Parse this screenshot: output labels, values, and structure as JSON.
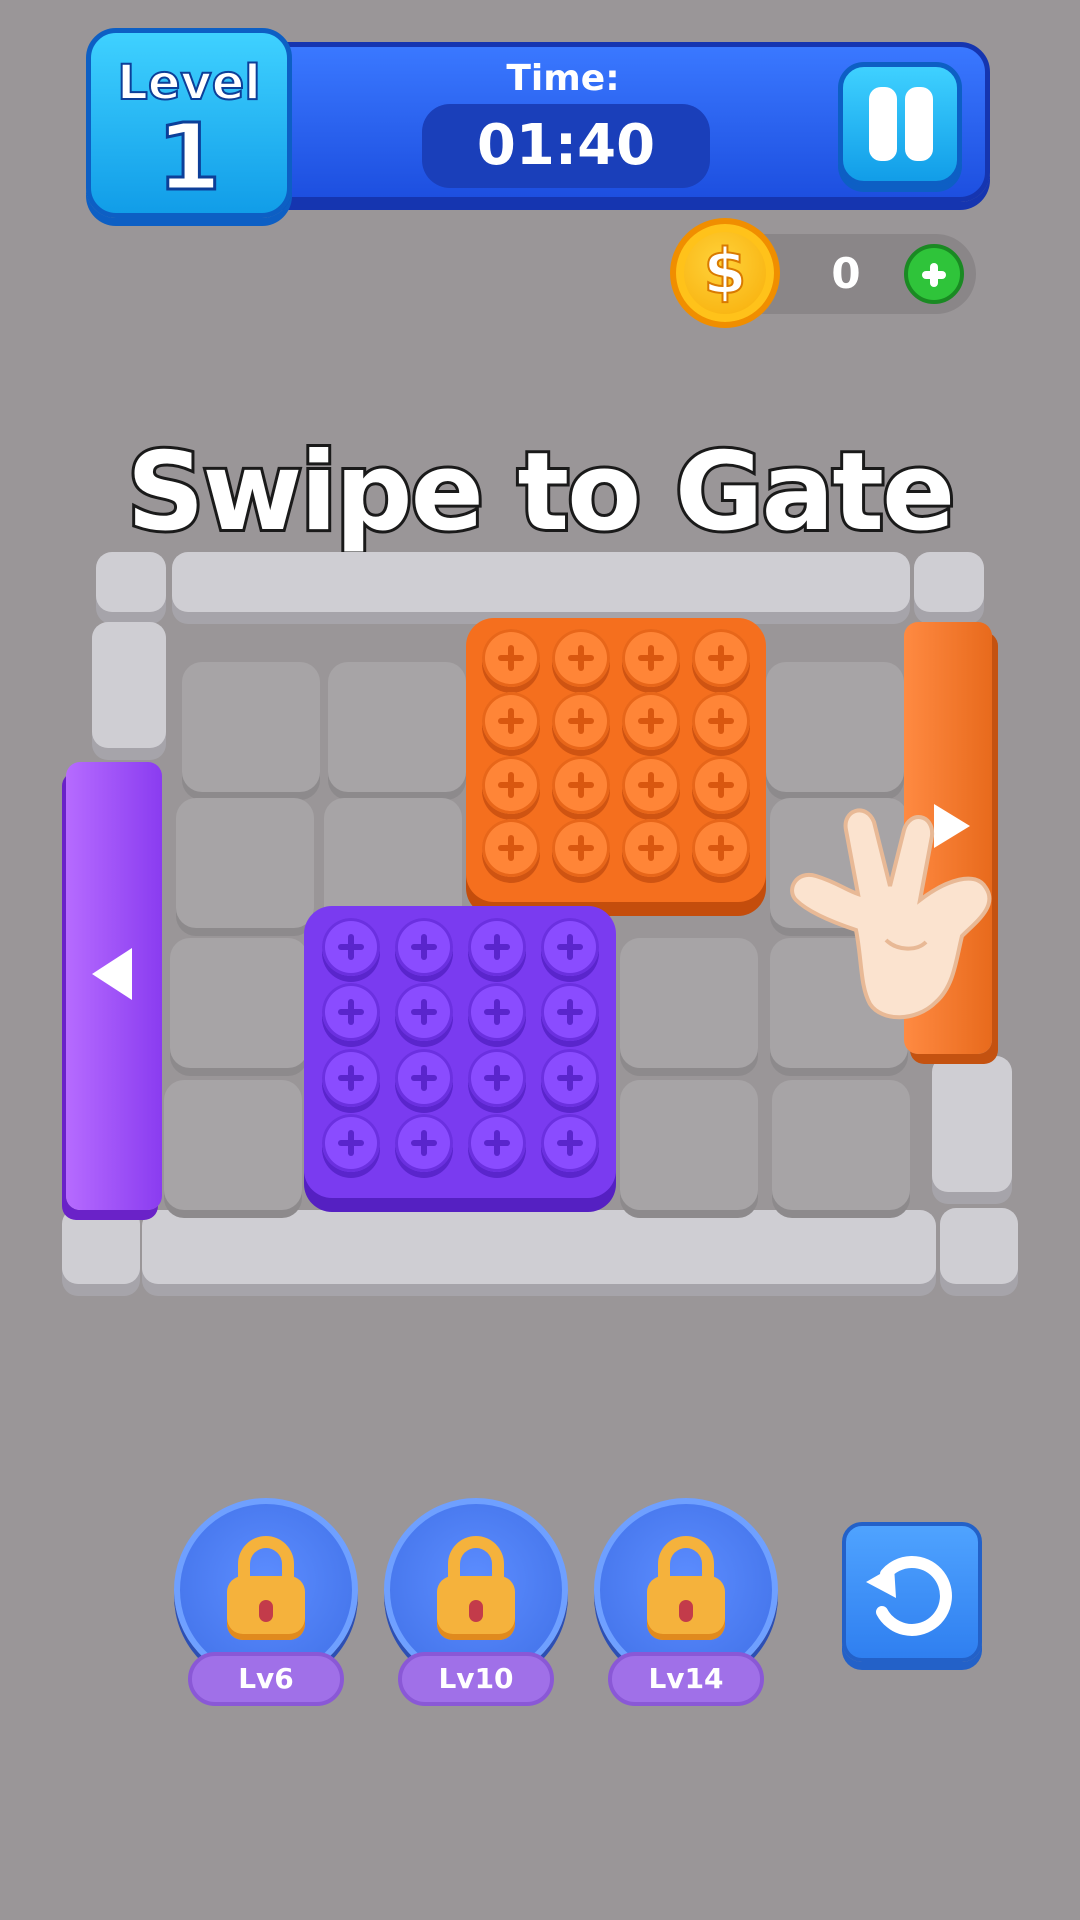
{
  "hud": {
    "level_label": "Level",
    "level_number": "1",
    "time_label": "Time:",
    "time_value": "01:40",
    "coins": "0",
    "icons": [
      "pause-icon",
      "coin-icon",
      "plus-icon"
    ]
  },
  "title": "Swipe to Gate",
  "board": {
    "rows": 4,
    "cols": 5,
    "blocks": [
      {
        "color": "orange",
        "color_hex": "#f56f1e",
        "studs": 16
      },
      {
        "color": "purple",
        "color_hex": "#7a3bf0",
        "studs": 16
      }
    ],
    "gates": [
      {
        "color": "orange",
        "side": "right",
        "arrow": "right"
      },
      {
        "color": "purple",
        "side": "left",
        "arrow": "left"
      }
    ]
  },
  "boosters": [
    {
      "label": "Lv6",
      "locked": true
    },
    {
      "label": "Lv10",
      "locked": true
    },
    {
      "label": "Lv14",
      "locked": true
    }
  ],
  "restart_icon": "restart-icon",
  "colors": {
    "background": "#9a9698",
    "header": "#1d4fe0",
    "accent": "#3fd1ff"
  }
}
